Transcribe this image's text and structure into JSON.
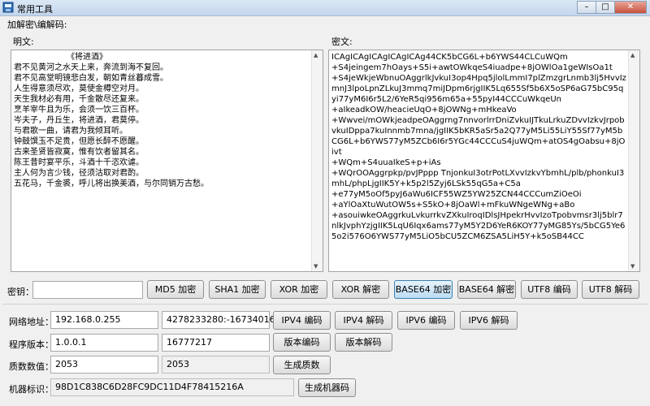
{
  "window": {
    "title": "常用工具",
    "minimize": "–",
    "maximize": "□",
    "close": "✕"
  },
  "group": {
    "label": "加解密\\编解码:"
  },
  "plain": {
    "label": "明文:",
    "text": "　　　　　　　《将进酒》\n君不见黄河之水天上来，奔流到海不复回。\n君不见高堂明镜悲白发，朝如青丝暮成雪。\n人生得意须尽欢，莫使金樽空对月。\n天生我材必有用，千金散尽还复来。\n烹羊宰牛且为乐，会须一饮三百杯。\n岑夫子，丹丘生，将进酒，君莫停。\n与君歌一曲，请君为我倾耳听。\n钟鼓馔玉不足贵，但愿长醉不愿醒。\n古来圣贤皆寂寞，惟有饮者留其名。\n陈王昔时宴平乐，斗酒十千恣欢谑。\n主人何为言少钱，径须沽取对君酌。\n五花马，千金裘，呼儿将出换美酒，与尔同销万古愁。"
  },
  "cipher": {
    "label": "密文:",
    "text": "ICAgICAgICAgICAgICAg44CK5bCG6L+b6YWS44CLCuWQm\n+S4jeingem7hOays+S5i+awtOWkqeS4iuadpe+8jOWlOa1geWIsOa1t\n+S4jeWkjeWbnuOAggrlkJvkuI3op4Hpq5jlolLmmI7plZmzgrLnmb3lj5HvvIzmnJ3lpoLpnZLkuJ3mmq7miJDpm6rjgIIK5Lq655Sf5b6X5oSP6aG75bC95qyi77yM6I6r5L2/6YeR5qi956m65a+55pyI44CCCuWkqeUn\n+aIkeadkOW/heacieUqO+8jOWNg+mHkeaVo\n+Wwvei/mOWkjeadpeOAggrng7nnvorlrrDniZvkuIJTkuLrkuZDvvIzkvJrpobvkuIDppa7kuInnmb7mna/jgIIK5bKR5aSr5a2Q77yM5Li55LiY55Sf77yM5bCG6L+b6YWS77yM5ZCb6I6r5YGc44CCCuS4juWQm+atOS4gOabsu+8jOivt\n+WQm+S4uuaIkeS+p+iAs\n+WQrOOAggrpkp/pvJPppp TnjonkuI3otrPotLXvvIzkvYbmhL/plb/phonkuI3mhL/phpLjgIIK5Y+k5p2l5Zyj6LSk55qG5a+C5a\n+e77yM5oOf5pyJ6aWu6ICF55WZ5YW25ZCN44CCCumZiOeOi\n+aYlOaXtuWutOW5s+S5kO+8jOaWl+mFkuWNgeWNg+aBo\n+asouiwkeOAggrkuLvkurrkvZXkuIroqIDlsJHpekrHvvIzoTpobvmsr3lj5blr7nlkJvphYzjgIIK5LqU6Iqx6ams77yM5Y2D6YeR6KOY77yMG85Ys/5bCG5Ye65o2i576O6YWS77yM5LiO5bCU5ZCM6ZSA5LiH5Y+k5oSB44CC"
  },
  "key": {
    "label": "密钥：",
    "value": ""
  },
  "buttons": {
    "md5": "MD5 加密",
    "sha1": "SHA1 加密",
    "xor_enc": "XOR 加密",
    "xor_dec": "XOR 解密",
    "b64_enc": "BASE64 加密",
    "b64_dec": "BASE64 解密",
    "utf8_enc": "UTF8 编码",
    "utf8_dec": "UTF8 解码"
  },
  "network": {
    "label": "网络地址：",
    "address": "192.168.0.255",
    "encoded": "4278233280:-16734016",
    "ipv4_enc": "IPV4 编码",
    "ipv4_dec": "IPV4 解码",
    "ipv6_enc": "IPV6 编码",
    "ipv6_dec": "IPV6 解码"
  },
  "version": {
    "label": "程序版本：",
    "value": "1.0.0.1",
    "encoded": "16777217",
    "enc": "版本编码",
    "dec": "版本解码"
  },
  "prime": {
    "label": "质数数值：",
    "value": "2053",
    "result": "2053",
    "gen": "生成质数"
  },
  "machine": {
    "label": "机器标识：",
    "value": "98D1C838C6D28FC9DC11D4F78415216A",
    "gen": "生成机器码"
  }
}
